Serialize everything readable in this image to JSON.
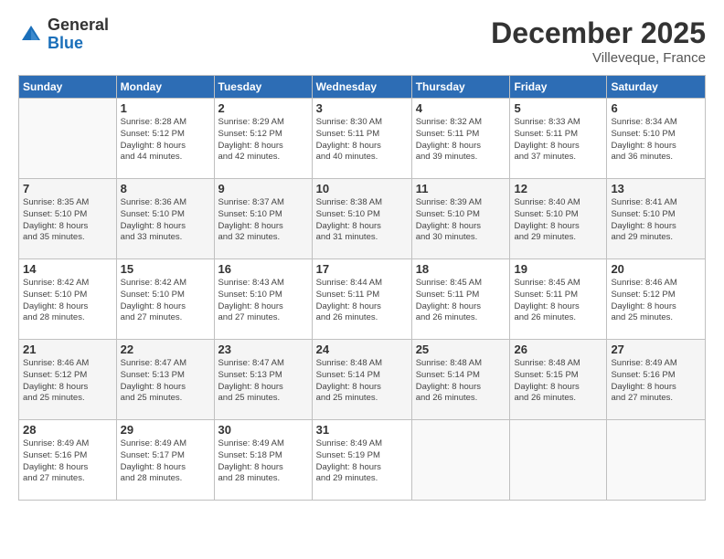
{
  "logo": {
    "general": "General",
    "blue": "Blue"
  },
  "header": {
    "month": "December 2025",
    "location": "Villeveque, France"
  },
  "days_of_week": [
    "Sunday",
    "Monday",
    "Tuesday",
    "Wednesday",
    "Thursday",
    "Friday",
    "Saturday"
  ],
  "weeks": [
    [
      {
        "day": "",
        "detail": ""
      },
      {
        "day": "1",
        "detail": "Sunrise: 8:28 AM\nSunset: 5:12 PM\nDaylight: 8 hours\nand 44 minutes."
      },
      {
        "day": "2",
        "detail": "Sunrise: 8:29 AM\nSunset: 5:12 PM\nDaylight: 8 hours\nand 42 minutes."
      },
      {
        "day": "3",
        "detail": "Sunrise: 8:30 AM\nSunset: 5:11 PM\nDaylight: 8 hours\nand 40 minutes."
      },
      {
        "day": "4",
        "detail": "Sunrise: 8:32 AM\nSunset: 5:11 PM\nDaylight: 8 hours\nand 39 minutes."
      },
      {
        "day": "5",
        "detail": "Sunrise: 8:33 AM\nSunset: 5:11 PM\nDaylight: 8 hours\nand 37 minutes."
      },
      {
        "day": "6",
        "detail": "Sunrise: 8:34 AM\nSunset: 5:10 PM\nDaylight: 8 hours\nand 36 minutes."
      }
    ],
    [
      {
        "day": "7",
        "detail": "Sunrise: 8:35 AM\nSunset: 5:10 PM\nDaylight: 8 hours\nand 35 minutes."
      },
      {
        "day": "8",
        "detail": "Sunrise: 8:36 AM\nSunset: 5:10 PM\nDaylight: 8 hours\nand 33 minutes."
      },
      {
        "day": "9",
        "detail": "Sunrise: 8:37 AM\nSunset: 5:10 PM\nDaylight: 8 hours\nand 32 minutes."
      },
      {
        "day": "10",
        "detail": "Sunrise: 8:38 AM\nSunset: 5:10 PM\nDaylight: 8 hours\nand 31 minutes."
      },
      {
        "day": "11",
        "detail": "Sunrise: 8:39 AM\nSunset: 5:10 PM\nDaylight: 8 hours\nand 30 minutes."
      },
      {
        "day": "12",
        "detail": "Sunrise: 8:40 AM\nSunset: 5:10 PM\nDaylight: 8 hours\nand 29 minutes."
      },
      {
        "day": "13",
        "detail": "Sunrise: 8:41 AM\nSunset: 5:10 PM\nDaylight: 8 hours\nand 29 minutes."
      }
    ],
    [
      {
        "day": "14",
        "detail": "Sunrise: 8:42 AM\nSunset: 5:10 PM\nDaylight: 8 hours\nand 28 minutes."
      },
      {
        "day": "15",
        "detail": "Sunrise: 8:42 AM\nSunset: 5:10 PM\nDaylight: 8 hours\nand 27 minutes."
      },
      {
        "day": "16",
        "detail": "Sunrise: 8:43 AM\nSunset: 5:10 PM\nDaylight: 8 hours\nand 27 minutes."
      },
      {
        "day": "17",
        "detail": "Sunrise: 8:44 AM\nSunset: 5:11 PM\nDaylight: 8 hours\nand 26 minutes."
      },
      {
        "day": "18",
        "detail": "Sunrise: 8:45 AM\nSunset: 5:11 PM\nDaylight: 8 hours\nand 26 minutes."
      },
      {
        "day": "19",
        "detail": "Sunrise: 8:45 AM\nSunset: 5:11 PM\nDaylight: 8 hours\nand 26 minutes."
      },
      {
        "day": "20",
        "detail": "Sunrise: 8:46 AM\nSunset: 5:12 PM\nDaylight: 8 hours\nand 25 minutes."
      }
    ],
    [
      {
        "day": "21",
        "detail": "Sunrise: 8:46 AM\nSunset: 5:12 PM\nDaylight: 8 hours\nand 25 minutes."
      },
      {
        "day": "22",
        "detail": "Sunrise: 8:47 AM\nSunset: 5:13 PM\nDaylight: 8 hours\nand 25 minutes."
      },
      {
        "day": "23",
        "detail": "Sunrise: 8:47 AM\nSunset: 5:13 PM\nDaylight: 8 hours\nand 25 minutes."
      },
      {
        "day": "24",
        "detail": "Sunrise: 8:48 AM\nSunset: 5:14 PM\nDaylight: 8 hours\nand 25 minutes."
      },
      {
        "day": "25",
        "detail": "Sunrise: 8:48 AM\nSunset: 5:14 PM\nDaylight: 8 hours\nand 26 minutes."
      },
      {
        "day": "26",
        "detail": "Sunrise: 8:48 AM\nSunset: 5:15 PM\nDaylight: 8 hours\nand 26 minutes."
      },
      {
        "day": "27",
        "detail": "Sunrise: 8:49 AM\nSunset: 5:16 PM\nDaylight: 8 hours\nand 27 minutes."
      }
    ],
    [
      {
        "day": "28",
        "detail": "Sunrise: 8:49 AM\nSunset: 5:16 PM\nDaylight: 8 hours\nand 27 minutes."
      },
      {
        "day": "29",
        "detail": "Sunrise: 8:49 AM\nSunset: 5:17 PM\nDaylight: 8 hours\nand 28 minutes."
      },
      {
        "day": "30",
        "detail": "Sunrise: 8:49 AM\nSunset: 5:18 PM\nDaylight: 8 hours\nand 28 minutes."
      },
      {
        "day": "31",
        "detail": "Sunrise: 8:49 AM\nSunset: 5:19 PM\nDaylight: 8 hours\nand 29 minutes."
      },
      {
        "day": "",
        "detail": ""
      },
      {
        "day": "",
        "detail": ""
      },
      {
        "day": "",
        "detail": ""
      }
    ]
  ]
}
